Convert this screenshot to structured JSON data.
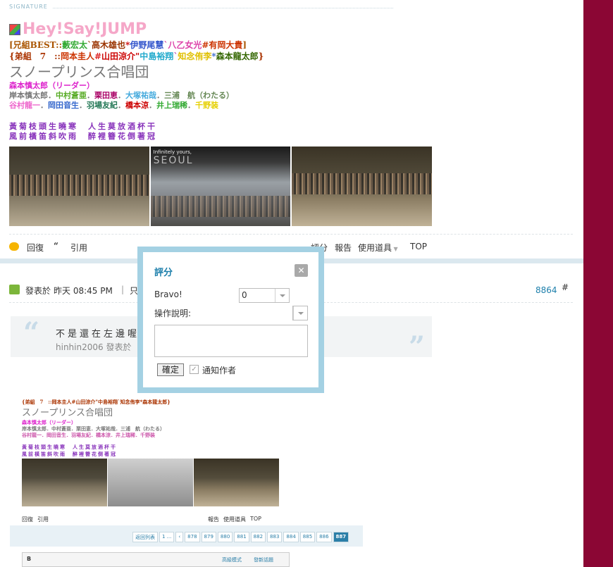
{
  "signature": {
    "header": "SIGNATURE",
    "jump_title": "Hey!Say!JUMP",
    "line1": [
      {
        "t": "[兄組BEST::",
        "c": "#aa5500"
      },
      {
        "t": "藪宏太",
        "c": "#33aa33"
      },
      {
        "t": "`高木雄也",
        "c": "#993300"
      },
      {
        "t": "*",
        "c": "#cc0000"
      },
      {
        "t": "伊野尾慧",
        "c": "#3355cc"
      },
      {
        "t": "`",
        "c": "#cc3399"
      },
      {
        "t": "八乙女光",
        "c": "#dd44aa"
      },
      {
        "t": "#",
        "c": "#cc3300"
      },
      {
        "t": "有岡大貴",
        "c": "#cc3300"
      },
      {
        "t": "]",
        "c": "#aa5500"
      }
    ],
    "line2": [
      {
        "t": "{弟組　7　::",
        "c": "#aa3300"
      },
      {
        "t": "岡本圭人",
        "c": "#cc3300"
      },
      {
        "t": "#",
        "c": "#dd2222"
      },
      {
        "t": "山田涼介",
        "c": "#cc0000"
      },
      {
        "t": "\"",
        "c": "#cc0000"
      },
      {
        "t": "中島裕翔",
        "c": "#22aacc"
      },
      {
        "t": "`",
        "c": "#aa33aa"
      },
      {
        "t": "知念侑李",
        "c": "#e0c000"
      },
      {
        "t": "*",
        "c": "#3366cc"
      },
      {
        "t": "森本龍太郎",
        "c": "#336600"
      },
      {
        "t": "}",
        "c": "#aa3300"
      }
    ],
    "choir": "スノープリンス合唱団",
    "line3": [
      {
        "t": "森本慎太郎（リーダー）",
        "c": "#dd22cc"
      }
    ],
    "line4": [
      {
        "t": "岸本慎太郎",
        "c": "#777777"
      },
      {
        "t": "．",
        "c": "#777777"
      },
      {
        "t": "中村蒼亜",
        "c": "#55aa22"
      },
      {
        "t": "．",
        "c": "#777777"
      },
      {
        "t": "栗田恵",
        "c": "#aa0066"
      },
      {
        "t": "．",
        "c": "#777777"
      },
      {
        "t": "大塚祐哉",
        "c": "#44aadd"
      },
      {
        "t": "．",
        "c": "#777777"
      },
      {
        "t": "三浦　航（わたる）",
        "c": "#668855"
      }
    ],
    "line5": [
      {
        "t": "谷村龍一",
        "c": "#ee66cc"
      },
      {
        "t": "．",
        "c": "#777777"
      },
      {
        "t": "岡田音生",
        "c": "#3366cc"
      },
      {
        "t": "．",
        "c": "#777777"
      },
      {
        "t": "羽場友紀",
        "c": "#227755"
      },
      {
        "t": "．",
        "c": "#777777"
      },
      {
        "t": "橋本涼",
        "c": "#cc0000"
      },
      {
        "t": "．",
        "c": "#777777"
      },
      {
        "t": "井上瑞稀",
        "c": "#33aa33"
      },
      {
        "t": "．",
        "c": "#777777"
      },
      {
        "t": "千野装",
        "c": "#e6d000"
      }
    ],
    "poem1": "黃菊枝頭生曉寒　人生莫放酒杯干",
    "poem2": "風前橫笛斜吹雨　醉裡簪花倒著冠",
    "photo2_caption": "Infinitely yours,",
    "photo2_text": "SEOUL"
  },
  "actions": {
    "reply": "回復",
    "quote": "引用",
    "rate": "評分",
    "report": "報告",
    "tools": "使用道具",
    "top": "TOP"
  },
  "post": {
    "meta_prefix": "發表於",
    "time": "昨天 08:45 PM",
    "sep": "|",
    "only": "只",
    "floor": "8864",
    "floor_mark": "#",
    "quote_text": "不是還在左邊喔",
    "quote_by": "hinhin2006 發表於"
  },
  "shot": {
    "line2": "{弟組　7　::岡本圭人#山田涼介\"中島裕翔`知念侑李*森本龍太郎}",
    "choir": "スノープリンス合唱団",
    "line3": "森本慎太郎（リーダー）",
    "line4": "岸本慎太郎．中村蒼亜．栗田恵．大塚祐哉．三浦　航（わたる）",
    "line5": "谷村龍一．岡田音生．羽場友紀．橋本涼．井上瑞稀．千野装",
    "poem1": "黃菊枝頭生曉寒　人生莫放酒杯干",
    "poem2": "風前橫笛斜吹雨　醉裡簪花倒著冠",
    "reply": "回復",
    "quote": "引用",
    "report": "報告",
    "tools": "使用道具",
    "top": "TOP",
    "back": "返回列表",
    "pages": [
      "1 ...",
      "‹",
      "878",
      "879",
      "880",
      "881",
      "882",
      "883",
      "884",
      "885",
      "886",
      "887"
    ],
    "editor_adv": "高級模式",
    "editor_new": "發新話題"
  },
  "popup": {
    "title": "評分",
    "close": "✕",
    "bravo_label": "Bravo!",
    "bravo_value": "0",
    "reason_label": "操作說明:",
    "ok": "確定",
    "notify": "通知作者"
  }
}
